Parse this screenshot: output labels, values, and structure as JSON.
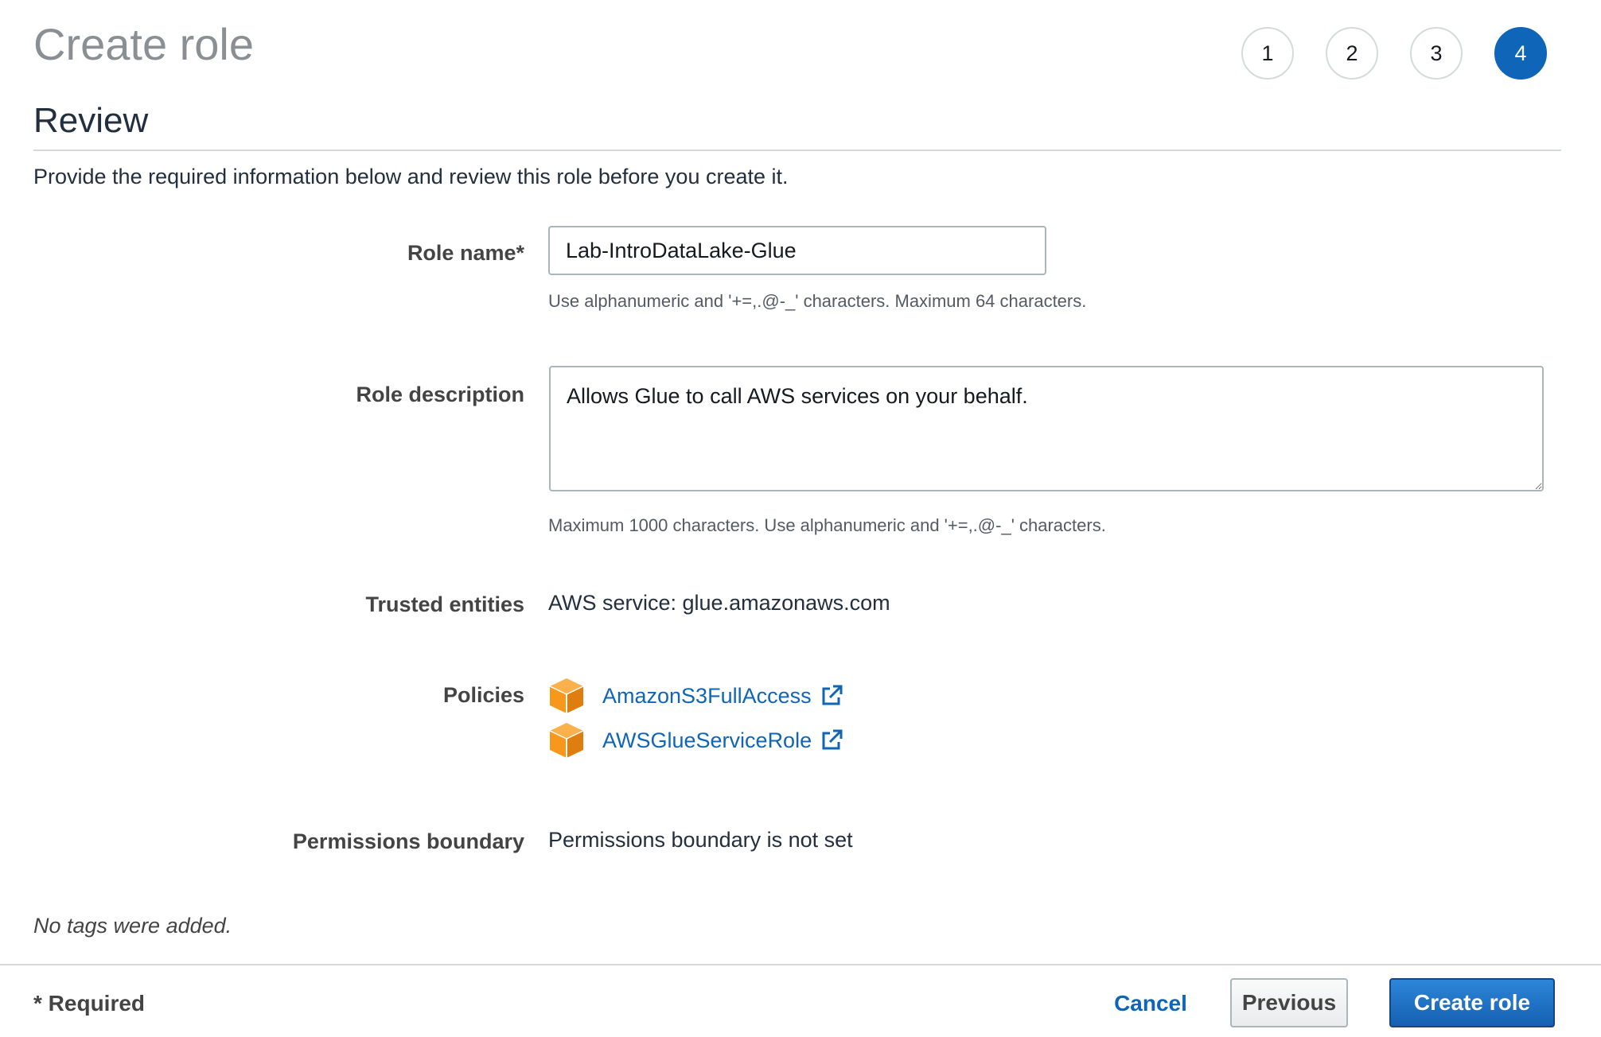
{
  "header": {
    "title": "Create role",
    "steps": [
      "1",
      "2",
      "3",
      "4"
    ],
    "active_step": "4"
  },
  "section": {
    "title": "Review",
    "intro": "Provide the required information below and review this role before you create it."
  },
  "form": {
    "role_name": {
      "label": "Role name*",
      "value": "Lab-IntroDataLake-Glue",
      "hint": "Use alphanumeric and '+=,.@-_' characters. Maximum 64 characters."
    },
    "role_description": {
      "label": "Role description",
      "value": "Allows Glue to call AWS services on your behalf.",
      "hint": "Maximum 1000 characters. Use alphanumeric and '+=,.@-_' characters."
    },
    "trusted_entities": {
      "label": "Trusted entities",
      "value": "AWS service: glue.amazonaws.com"
    },
    "policies": {
      "label": "Policies",
      "items": [
        {
          "name": "AmazonS3FullAccess",
          "icon": "policy-cube-icon",
          "link_icon": "external-link-icon"
        },
        {
          "name": "AWSGlueServiceRole",
          "icon": "policy-cube-icon",
          "link_icon": "external-link-icon"
        }
      ]
    },
    "permissions_boundary": {
      "label": "Permissions boundary",
      "value": "Permissions boundary is not set"
    },
    "tags_note": "No tags were added."
  },
  "footer": {
    "required_note": "* Required",
    "cancel_label": "Cancel",
    "previous_label": "Previous",
    "create_label": "Create role"
  },
  "colors": {
    "accent": "#0f65b8",
    "policy_icon": "#f7981d"
  }
}
